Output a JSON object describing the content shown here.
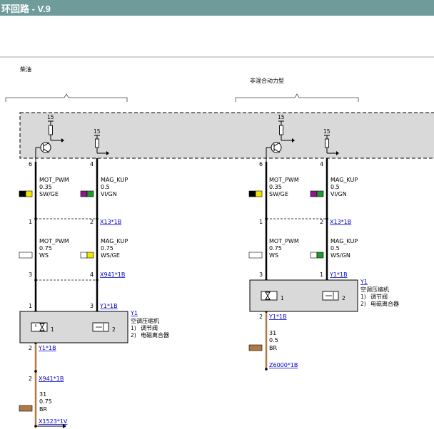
{
  "header": {
    "title": "环回路 - V.9",
    "color": "#6f9c9a"
  },
  "variants": [
    {
      "label": "柴油"
    },
    {
      "label": "非混合动力型"
    }
  ],
  "supply_label": "15",
  "wires": {
    "mot_pwm_a": {
      "name": "MOT_PWM",
      "size": "0.35",
      "color": "SW/GE"
    },
    "mag_kup_a": {
      "name": "MAG_KUP",
      "size": "0.5",
      "color": "VI/GN"
    },
    "mot_pwm_b": {
      "name": "MOT_PWM",
      "size": "0.75",
      "color": "WS"
    },
    "mag_kup_b_left": {
      "name": "MAG_KUP",
      "size": "0.75",
      "color": "WS/GE"
    },
    "mag_kup_b_right": {
      "name": "MAG_KUP",
      "size": "0.5",
      "color": "WS/GN"
    },
    "ground_left": {
      "name": "31",
      "size": "0.75",
      "color": "BR"
    },
    "ground_right": {
      "name": "31",
      "size": "0.5",
      "color": "BR"
    }
  },
  "pins": {
    "p6": "6",
    "p4": "4",
    "p1": "1",
    "p2": "2",
    "p3": "3"
  },
  "connectors": {
    "x13": "X13*1B",
    "x941_3": "X941*1B",
    "y1_left": "Y1*1B",
    "y1_right": "Y1*1B",
    "y1_ground": "Y1*1B",
    "x941_ground": "X941*1B",
    "x1523": "X1523*1V",
    "z6000": "Z6000*1B"
  },
  "component": {
    "id": "Y1",
    "name": "空调压缩机",
    "items": [
      "调节阀",
      "电磁离合器"
    ],
    "item_numbers": [
      "1)",
      "2)"
    ],
    "element_numbers": [
      "1",
      "2"
    ]
  },
  "colors": {
    "SW": "#000000",
    "GE": "#f2e600",
    "VI": "#8c1a8c",
    "GN": "#1c9b2c",
    "WS": "#ffffff",
    "BR": "#b07a44",
    "ECU_fill": "#d9d9d9",
    "component_fill": "#d9d9d9"
  }
}
